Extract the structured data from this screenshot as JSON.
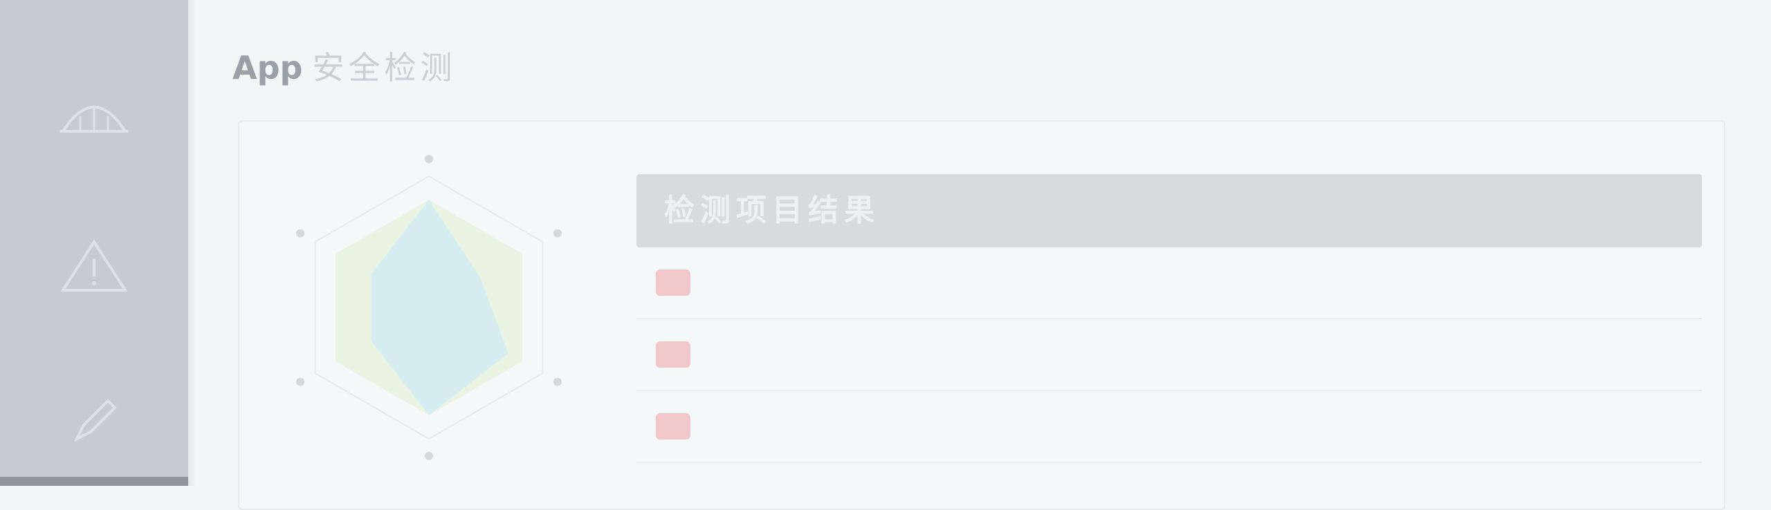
{
  "sidebar": {
    "items": [
      {
        "label": "",
        "icon": "app-icon"
      },
      {
        "label": "",
        "icon": "bridge-icon"
      },
      {
        "label": "",
        "icon": "triangle-warning-icon"
      },
      {
        "label": "",
        "icon": "pen-icon"
      }
    ]
  },
  "header": {
    "app": "App",
    "subtitle": "安全检测"
  },
  "radar": {
    "axes": 6,
    "value_fractions": [
      1.0,
      0.55,
      0.85,
      1.0,
      0.62,
      0.62
    ],
    "colors": {
      "outer": "#e9f4e3",
      "inner": "#d6eef1",
      "grid": "#e6eaec"
    }
  },
  "table": {
    "header": "检测项目结果",
    "rows": [
      {
        "badge": "",
        "name": "",
        "desc": ""
      },
      {
        "badge": "",
        "name": "",
        "desc": ""
      },
      {
        "badge": "",
        "name": "",
        "desc": ""
      }
    ]
  }
}
